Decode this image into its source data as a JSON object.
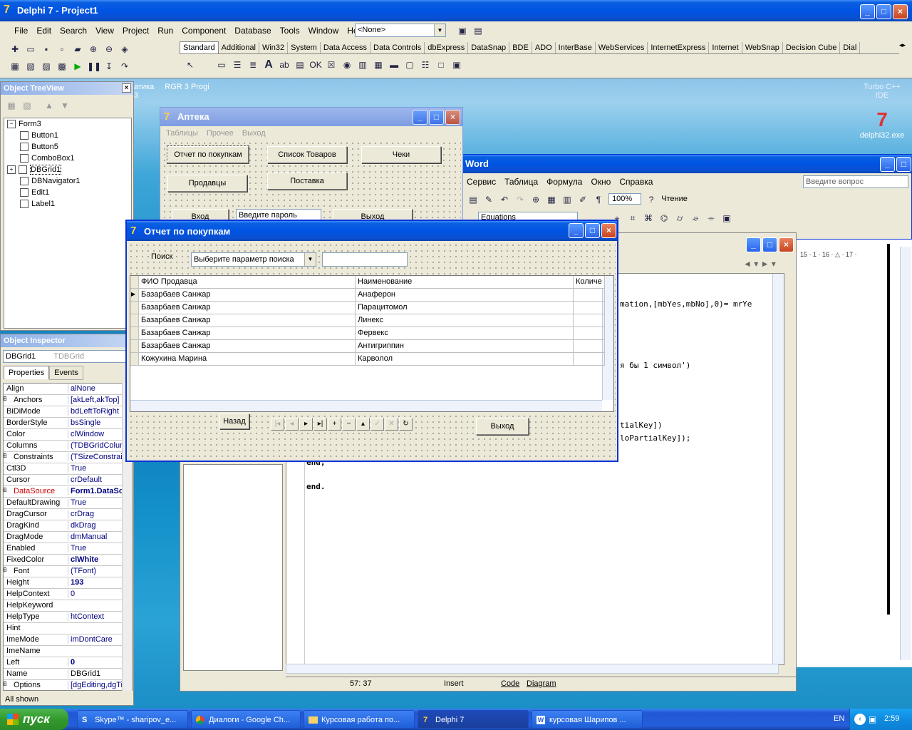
{
  "ide": {
    "title": "Delphi 7 - Project1",
    "menu": [
      "File",
      "Edit",
      "Search",
      "View",
      "Project",
      "Run",
      "Component",
      "Database",
      "Tools",
      "Window",
      "Help"
    ],
    "combo_value": "<None>",
    "palette_tabs": [
      "Standard",
      "Additional",
      "Win32",
      "System",
      "Data Access",
      "Data Controls",
      "dbExpress",
      "DataSnap",
      "BDE",
      "ADO",
      "InterBase",
      "WebServices",
      "InternetExpress",
      "Internet",
      "WebSnap",
      "Decision Cube",
      "Dial"
    ]
  },
  "desktop": {
    "icon_top_label": "Turbo C++",
    "icon_top_sub": "IDE",
    "icon_exe": "delphi32.exe",
    "bg_text_left": "атика",
    "bg_text_mid": "RGR 3 Progi",
    "bg_text_3": "3"
  },
  "tree": {
    "title": "Object TreeView",
    "items": [
      "Form3",
      "Button1",
      "Button5",
      "ComboBox1",
      "DBGrid1",
      "DBNavigator1",
      "Edit1",
      "Label1"
    ]
  },
  "inspector": {
    "title": "Object Inspector",
    "object": "DBGrid1",
    "type": "TDBGrid",
    "tab_properties": "Properties",
    "tab_events": "Events",
    "footer": "All shown",
    "rows": [
      [
        "Align",
        "alNone"
      ],
      [
        "Anchors",
        "[akLeft,akTop]"
      ],
      [
        "BiDiMode",
        "bdLeftToRight"
      ],
      [
        "BorderStyle",
        "bsSingle"
      ],
      [
        "Color",
        "clWindow"
      ],
      [
        "Columns",
        "(TDBGridColum"
      ],
      [
        "Constraints",
        "(TSizeConstrain"
      ],
      [
        "Ctl3D",
        "True"
      ],
      [
        "Cursor",
        "crDefault"
      ],
      [
        "DataSource",
        "Form1.DataSo"
      ],
      [
        "DefaultDrawing",
        "True"
      ],
      [
        "DragCursor",
        "crDrag"
      ],
      [
        "DragKind",
        "dkDrag"
      ],
      [
        "DragMode",
        "dmManual"
      ],
      [
        "Enabled",
        "True"
      ],
      [
        "FixedColor",
        "clWhite"
      ],
      [
        "Font",
        "(TFont)"
      ],
      [
        "Height",
        "193"
      ],
      [
        "HelpContext",
        "0"
      ],
      [
        "HelpKeyword",
        ""
      ],
      [
        "HelpType",
        "htContext"
      ],
      [
        "Hint",
        ""
      ],
      [
        "ImeMode",
        "imDontCare"
      ],
      [
        "ImeName",
        ""
      ],
      [
        "Left",
        "0"
      ],
      [
        "Name",
        "DBGrid1"
      ],
      [
        "Options",
        "[dgEditing,dgTit"
      ]
    ]
  },
  "apteka": {
    "title": "Аптека",
    "menu": [
      "Таблицы",
      "Прочее",
      "Выход"
    ],
    "btn_report": "Отчет по покупкам",
    "btn_goods": "Список Товаров",
    "btn_checks": "Чеки",
    "btn_sellers": "Продавцы",
    "btn_supply": "Поставка",
    "btn_login": "Вход",
    "password": "Введите пароль",
    "btn_exit": "Выход"
  },
  "word": {
    "title": "Word",
    "menu": [
      "Сервис",
      "Таблица",
      "Формула",
      "Окно",
      "Справка"
    ],
    "ask": "Введите вопрос",
    "zoom": "100%",
    "read": "Чтение",
    "equations": "Equations",
    "ruler": "15 · 1 · 16 · △ · 17 ·"
  },
  "editor": {
    "lines": [
      "mation,[mbYes,mbNo],0)= mrYe",
      "я бы 1 символ')",
      "tialKey])",
      "loPartialKey]);",
      "end;",
      "end."
    ],
    "pos": "57:  37",
    "mode": "Insert",
    "tab_code": "Code",
    "tab_diagram": "Diagram"
  },
  "report": {
    "title": "Отчет по покупкам",
    "search_label": "Поиск",
    "search_combo": "Выберите параметр поиска",
    "search_value": "",
    "columns": [
      "ФИО Продавца",
      "Наименование",
      "Количе"
    ],
    "rows": [
      [
        "Базарбаев Санжар",
        "Анаферон"
      ],
      [
        "Базарбаев Санжар",
        "Парацитомол"
      ],
      [
        "Базарбаев Санжар",
        "Линекс"
      ],
      [
        "Базарбаев Санжар",
        "Фервекс"
      ],
      [
        "Базарбаев Санжар",
        "Антигриппин"
      ],
      [
        "Кожухина Марина",
        "Карволол"
      ]
    ],
    "btn_back": "Назад",
    "btn_exit": "Выход"
  },
  "taskbar": {
    "start": "пуск",
    "items": [
      "Skype™ - sharipov_e...",
      "Диалоги - Google Ch...",
      "Курсовая работа по...",
      "Delphi 7",
      "курсовая Шарипов ..."
    ],
    "lang": "EN",
    "time": "2:59"
  }
}
